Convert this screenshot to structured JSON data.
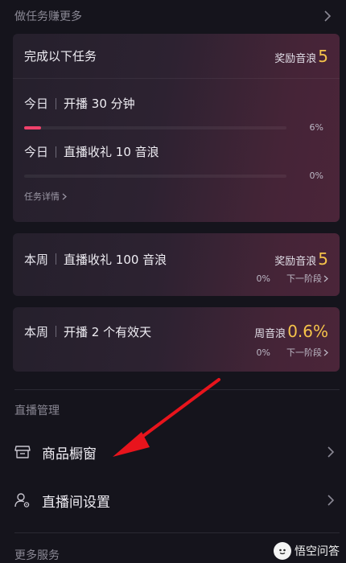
{
  "tasks_section": {
    "title": "做任务赚更多"
  },
  "daily_card": {
    "title": "完成以下任务",
    "reward_label": "奖励音浪",
    "reward_value": "5",
    "tasks": [
      {
        "prefix": "今日",
        "label": "开播 30 分钟",
        "progress_pct": "6%",
        "progress": 0.06
      },
      {
        "prefix": "今日",
        "label": "直播收礼 10 音浪",
        "progress_pct": "0%",
        "progress": 0.0
      }
    ],
    "details_link": "任务详情"
  },
  "weekly_cards": [
    {
      "prefix": "本周",
      "label": "直播收礼 100 音浪",
      "reward_label": "奖励音浪",
      "reward_value": "5",
      "progress_pct": "0%",
      "next_stage": "下一阶段"
    },
    {
      "prefix": "本周",
      "label": "开播 2 个有效天",
      "reward_label": "周音浪",
      "reward_value": "0.6%",
      "progress_pct": "0%",
      "next_stage": "下一阶段"
    }
  ],
  "live_management": {
    "title": "直播管理",
    "items": [
      {
        "label": "商品橱窗",
        "icon": "store-icon"
      },
      {
        "label": "直播间设置",
        "icon": "user-settings-icon"
      }
    ]
  },
  "more_services": {
    "title": "更多服务"
  },
  "watermark": {
    "text": "悟空问答"
  },
  "colors": {
    "accent_pink": "#f0416b",
    "reward_gold": "#f5c34a",
    "arrow_red": "#e8141c",
    "background": "#15141c"
  }
}
